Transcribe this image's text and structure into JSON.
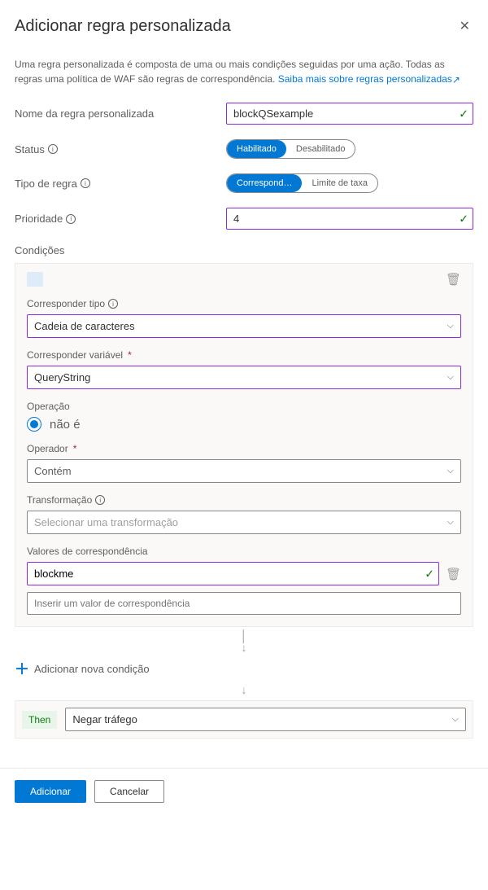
{
  "header": {
    "title": "Adicionar regra personalizada"
  },
  "intro": {
    "text_prefix": "Uma regra personalizada é composta de uma ou mais condições seguidas por uma ação. Todas as regras uma política de WAF são regras de correspondência. ",
    "link_text": "Saiba mais sobre regras personalizadas"
  },
  "fields": {
    "name_label": "Nome da regra personalizada",
    "name_value": "blockQSexample",
    "status_label": "Status",
    "status_options": {
      "enabled": "Habilitado",
      "disabled": "Desabilitado"
    },
    "rule_type_label": "Tipo de regra",
    "rule_type_options": {
      "match": "Correspond…",
      "rate": "Limite de taxa"
    },
    "priority_label": "Prioridade",
    "priority_value": "4"
  },
  "conditions": {
    "section_label": "Condições",
    "if_label": " ",
    "match_type_label": "Corresponder tipo",
    "match_type_value": "Cadeia de caracteres",
    "match_var_label": "Corresponder variável",
    "match_var_value": "QueryString",
    "operation_label": "Operação",
    "operation_option": "não é",
    "operator_label": "Operador",
    "operator_value": "Contém",
    "transform_label": "Transformação",
    "transform_placeholder": "Selecionar uma transformação",
    "match_values_label": "Valores de correspondência",
    "match_value_1": "blockme",
    "match_value_placeholder": "Inserir um valor de correspondência",
    "add_condition": "Adicionar nova condição"
  },
  "then": {
    "label": "Then",
    "action": "Negar tráfego"
  },
  "footer": {
    "add": "Adicionar",
    "cancel": "Cancelar"
  }
}
